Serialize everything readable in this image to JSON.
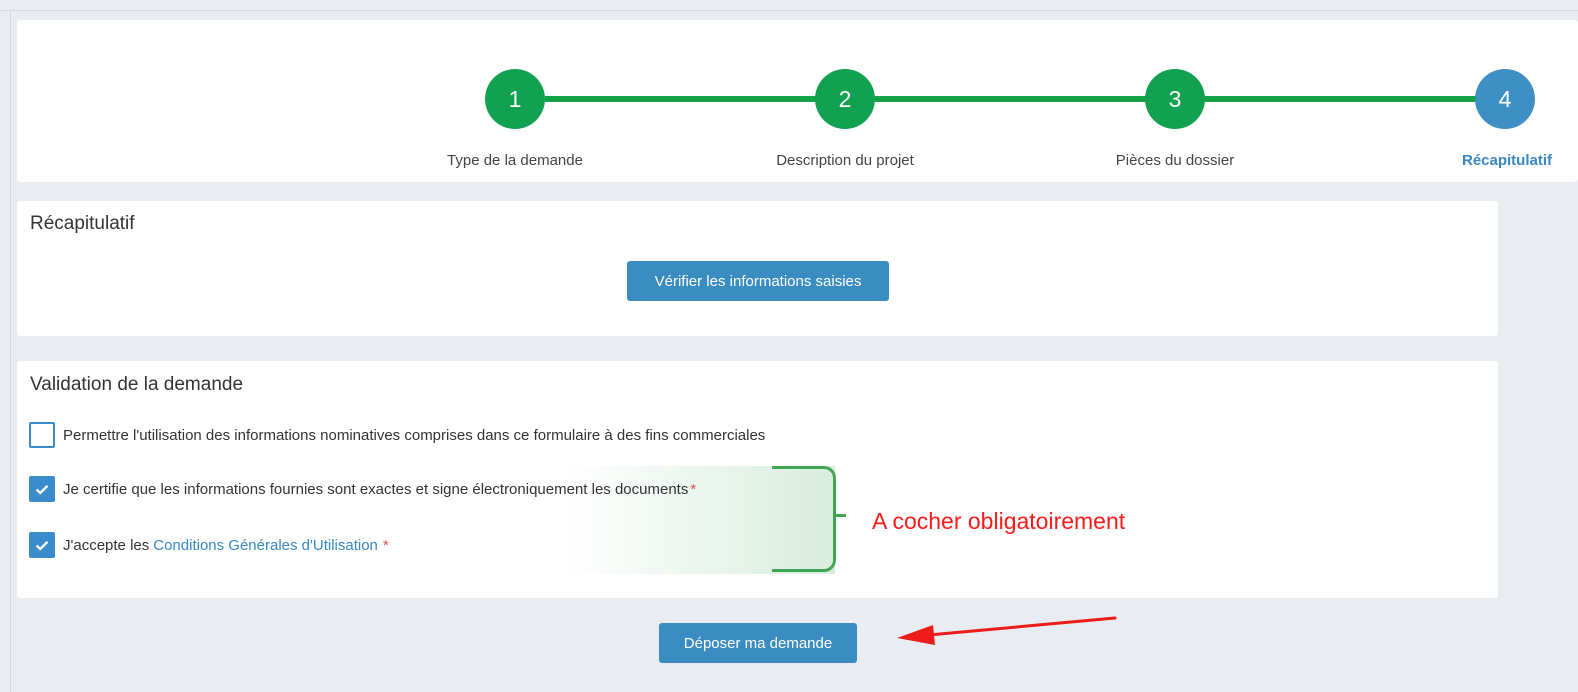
{
  "stepper": {
    "steps": [
      {
        "number": "1",
        "label": "Type de la demande",
        "state": "done"
      },
      {
        "number": "2",
        "label": "Description du projet",
        "state": "done"
      },
      {
        "number": "3",
        "label": "Pièces du dossier",
        "state": "done"
      },
      {
        "number": "4",
        "label": "Récapitulatif",
        "state": "active"
      }
    ],
    "colors": {
      "done": "#12a150",
      "active": "#3d8fc4",
      "line": "#13a14a"
    }
  },
  "recap": {
    "title": "Récapitulatif",
    "verify_button": "Vérifier les informations saisies"
  },
  "validation": {
    "title": "Validation de la demande",
    "options": [
      {
        "text": "Permettre l'utilisation des informations nominatives comprises dans ce formulaire à des fins commerciales",
        "checked": false,
        "required": false
      },
      {
        "text": "Je certifie que les informations fournies sont exactes et signe électroniquement les documents",
        "checked": true,
        "required": true,
        "required_mark": "*"
      },
      {
        "text": "J'accepte les",
        "link": "Conditions Générales d'Utilisation",
        "checked": true,
        "required": true,
        "required_mark": "*"
      }
    ]
  },
  "annotation": {
    "text": "A cocher obligatoirement",
    "color": "#ff1a1a"
  },
  "submit_button": "Déposer ma demande"
}
